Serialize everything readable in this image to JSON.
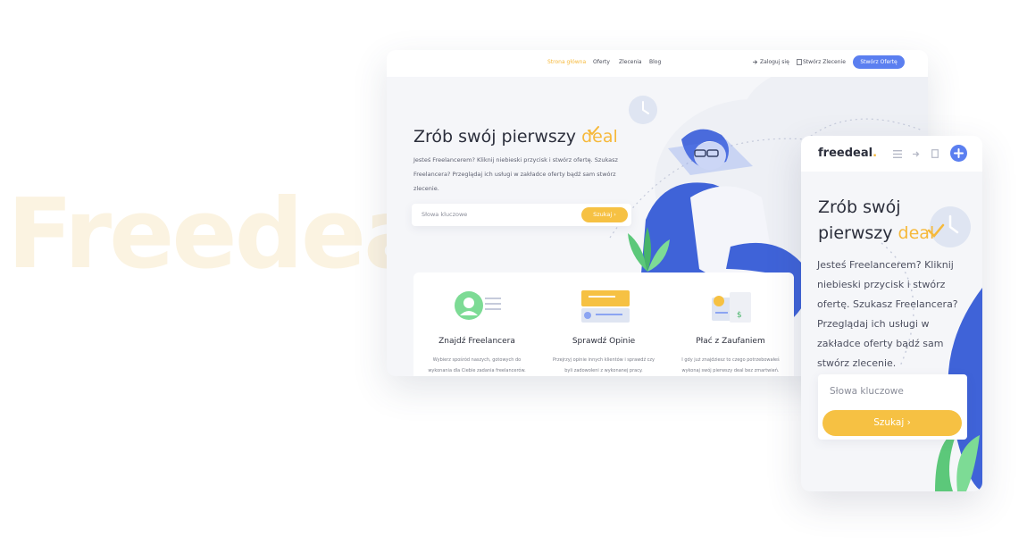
{
  "background_word": "Freedeal",
  "colors": {
    "accent": "#f6b93b",
    "primary": "#5b7ff0",
    "text": "#2c2f3c",
    "background": "#f5f6f9"
  },
  "desktop": {
    "nav": {
      "links": [
        "Strona główna",
        "Oferty",
        "Zlecenia",
        "Blog"
      ],
      "login": "Zaloguj się",
      "create_order": "Stwórz Zlecenie",
      "create_offer": "Stwórz Ofertę"
    },
    "hero": {
      "title": "Zrób swój pierwszy",
      "title_accent": "deal",
      "description": "Jesteś Freelancerem? Kliknij niebieski przycisk i stwórz ofertę. Szukasz Freelancera? Przeglądaj ich usługi w zakładce oferty bądź sam stwórz zlecenie."
    },
    "search": {
      "placeholder": "Słowa kluczowe",
      "button": "Szukaj ›"
    },
    "cards": [
      {
        "title": "Znajdź Freelancera",
        "text": "Wybierz spośród naszych, gotowych do wykonania dla Ciebie zadania freelancerów."
      },
      {
        "title": "Sprawdź Opinie",
        "text": "Przejrzyj opinie innych klientów i sprawdź czy byli zadowoleni z wykonanej pracy."
      },
      {
        "title": "Płać z Zaufaniem",
        "text": "I gdy już znajdziesz to czego potrzebowałeś wykonaj swój pierwszy deal bez zmartwień."
      }
    ]
  },
  "mobile": {
    "logo": "freedeal",
    "logo_dot": ".",
    "hero": {
      "title": "Zrób swój pierwszy",
      "title_accent": "deal",
      "description": "Jesteś Freelancerem? Kliknij niebieski przycisk i stwórz ofertę. Szukasz Freelancera? Przeglądaj ich usługi w zakładce oferty bądź sam stwórz zlecenie."
    },
    "search": {
      "placeholder": "Słowa kluczowe",
      "button": "Szukaj ›"
    }
  },
  "icons": [
    "menu-icon",
    "login-icon",
    "document-icon",
    "plus-icon",
    "clock-icon",
    "check-icon",
    "plant-icon"
  ]
}
